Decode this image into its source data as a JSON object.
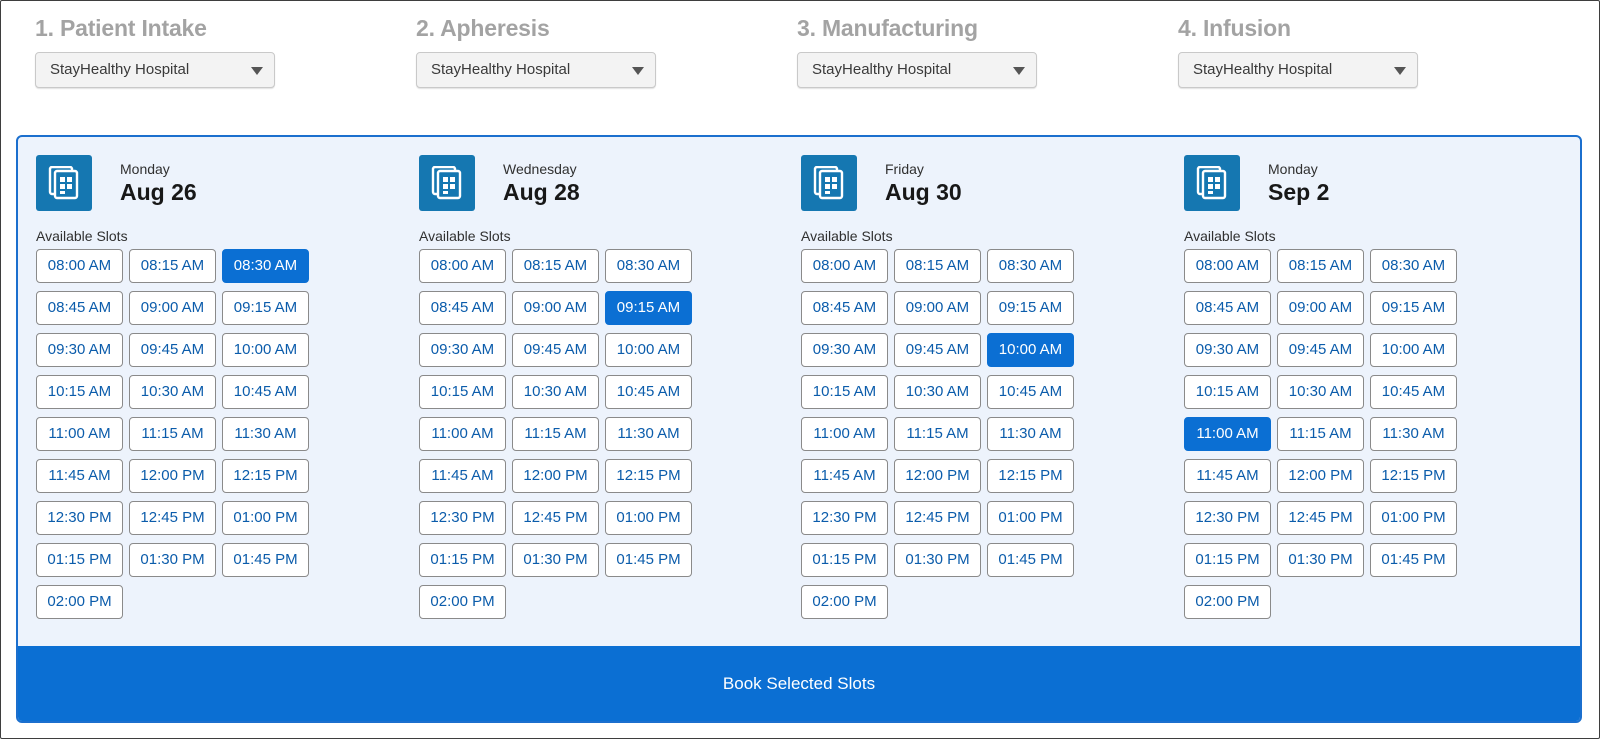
{
  "stages": [
    {
      "title": "1. Patient Intake",
      "location": "StayHealthy Hospital"
    },
    {
      "title": "2. Apheresis",
      "location": "StayHealthy Hospital"
    },
    {
      "title": "3. Manufacturing",
      "location": "StayHealthy Hospital"
    },
    {
      "title": "4. Infusion",
      "location": "StayHealthy Hospital"
    }
  ],
  "slots_label": "Available Slots",
  "days": [
    {
      "weekday": "Monday",
      "date": "Aug 26",
      "icon": "calendar-icon",
      "slots": [
        "08:00 AM",
        "08:15 AM",
        "08:30 AM",
        "08:45 AM",
        "09:00 AM",
        "09:15 AM",
        "09:30 AM",
        "09:45 AM",
        "10:00 AM",
        "10:15 AM",
        "10:30 AM",
        "10:45 AM",
        "11:00 AM",
        "11:15 AM",
        "11:30 AM",
        "11:45 AM",
        "12:00 PM",
        "12:15 PM",
        "12:30 PM",
        "12:45 PM",
        "01:00 PM",
        "01:15 PM",
        "01:30 PM",
        "01:45 PM",
        "02:00 PM"
      ],
      "selected": "08:30 AM"
    },
    {
      "weekday": "Wednesday",
      "date": "Aug 28",
      "icon": "calendar-icon",
      "slots": [
        "08:00 AM",
        "08:15 AM",
        "08:30 AM",
        "08:45 AM",
        "09:00 AM",
        "09:15 AM",
        "09:30 AM",
        "09:45 AM",
        "10:00 AM",
        "10:15 AM",
        "10:30 AM",
        "10:45 AM",
        "11:00 AM",
        "11:15 AM",
        "11:30 AM",
        "11:45 AM",
        "12:00 PM",
        "12:15 PM",
        "12:30 PM",
        "12:45 PM",
        "01:00 PM",
        "01:15 PM",
        "01:30 PM",
        "01:45 PM",
        "02:00 PM"
      ],
      "selected": "09:15 AM"
    },
    {
      "weekday": "Friday",
      "date": "Aug 30",
      "icon": "calendar-icon",
      "slots": [
        "08:00 AM",
        "08:15 AM",
        "08:30 AM",
        "08:45 AM",
        "09:00 AM",
        "09:15 AM",
        "09:30 AM",
        "09:45 AM",
        "10:00 AM",
        "10:15 AM",
        "10:30 AM",
        "10:45 AM",
        "11:00 AM",
        "11:15 AM",
        "11:30 AM",
        "11:45 AM",
        "12:00 PM",
        "12:15 PM",
        "12:30 PM",
        "12:45 PM",
        "01:00 PM",
        "01:15 PM",
        "01:30 PM",
        "01:45 PM",
        "02:00 PM"
      ],
      "selected": "10:00 AM"
    },
    {
      "weekday": "Monday",
      "date": "Sep 2",
      "icon": "calendar-icon",
      "slots": [
        "08:00 AM",
        "08:15 AM",
        "08:30 AM",
        "08:45 AM",
        "09:00 AM",
        "09:15 AM",
        "09:30 AM",
        "09:45 AM",
        "10:00 AM",
        "10:15 AM",
        "10:30 AM",
        "10:45 AM",
        "11:00 AM",
        "11:15 AM",
        "11:30 AM",
        "11:45 AM",
        "12:00 PM",
        "12:15 PM",
        "12:30 PM",
        "12:45 PM",
        "01:00 PM",
        "01:15 PM",
        "01:30 PM",
        "01:45 PM",
        "02:00 PM"
      ],
      "selected": "11:00 AM"
    }
  ],
  "book_button_label": "Book Selected Slots",
  "colors": {
    "accent": "#0b6fd3",
    "panel_bg": "#edf3fc",
    "icon_bg": "#1577b1",
    "stage_title": "#a3a3a3",
    "slot_text": "#0b5cab"
  }
}
